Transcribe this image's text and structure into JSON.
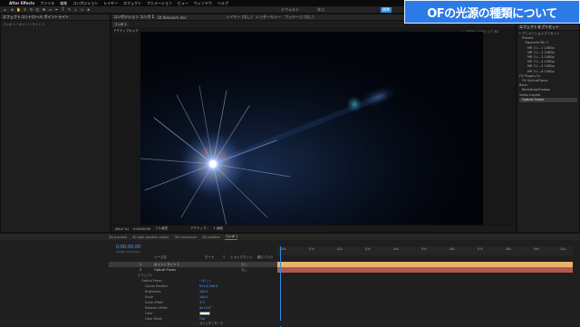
{
  "title_overlay": "OFの光源の種類について",
  "menubar": {
    "app": "After Effects",
    "items": [
      "ファイル",
      "編集",
      "コンポジション",
      "レイヤー",
      "エフェクト",
      "アニメーション",
      "ビュー",
      "ウィンドウ",
      "ヘルプ"
    ]
  },
  "toolbar": {
    "workspace_tabs": [
      "デフォルト",
      "学ぶ",
      "標準"
    ],
    "active_tab": "標準"
  },
  "effect_panel": {
    "tab": "エフェクトコントロール ポイントライト",
    "subline": "コンポ 1 • ポイントライト 1"
  },
  "comp_panel": {
    "tabs": [
      "コンポジション コンポ 1",
      "Bt.Newdom dec",
      "レイヤー (なし)",
      "レンダーキュー",
      "フッテージ (なし)"
    ],
    "inner_tab": "コンポ 1",
    "active_camera": "アクティブカメラ",
    "renderer": "レンダラー: クラシック 3D",
    "footer": [
      "(84.4 %)",
      "0:00:00:00",
      "フル画質",
      "アクティブ...",
      "1 画面"
    ]
  },
  "right_panel": {
    "header": "エフェクト＆プリセット",
    "tree": [
      "* アニメーションプリセット",
      "Presets",
      "Trapcode Mir 3",
      "MR 3 L...1 1080p",
      "MR 3 L...2 1080p",
      "MR 3 L...3 1080p",
      "MR 3 L...4 1080p",
      "MR 3 L...5 1080p",
      "MR 3 L...6 1080p",
      "FX Plugins Fx",
      "FX OpticalFlares",
      "Boris",
      "BorisDropShadow",
      "Video Copilot",
      "Optical Flares"
    ],
    "selected": "Optical Flares"
  },
  "timeline": {
    "tabs": [
      "3D preview",
      "3D light position colour",
      "3D luminance",
      "3D shelties",
      "コンポ 1"
    ],
    "active_tab": "コンポ 1",
    "timecode": "0:00:00:00",
    "frames": "00000 (30.00 fps)",
    "columns": [
      "ソース名",
      "モード",
      "T",
      "トラックマット",
      "親とリンク"
    ],
    "layers": [
      {
        "num": "1",
        "name": "ポイントライト 1",
        "mode": "なし",
        "color": "#e8b36a"
      },
      {
        "num": "2",
        "name": "Optical Flares",
        "mode": "なし",
        "color": "#d4796a"
      }
    ],
    "props": [
      {
        "name": "エフェクト",
        "value": ""
      },
      {
        "name": "Optical Flares",
        "value": "リセット"
      },
      {
        "name": "Center Position",
        "value": "814.8,506.0"
      },
      {
        "name": "Brightness",
        "value": "100.0"
      },
      {
        "name": "Scale",
        "value": "100.0"
      },
      {
        "name": "Scale Offset",
        "value": "オフ"
      },
      {
        "name": "Rotation Offset",
        "value": "0x+0.0°"
      },
      {
        "name": "Color",
        "value": ""
      },
      {
        "name": "Color Mode",
        "value": "Tint"
      }
    ],
    "ruler_ticks": [
      "00s",
      "01s",
      "02s",
      "03s",
      "04s",
      "05s",
      "06s",
      "07s",
      "08s",
      "09s",
      "10s"
    ],
    "footer": "スイッチ / モード"
  },
  "colors": {
    "accent": "#2d8ceb",
    "overlay": "#2b7ae6",
    "layer1": "#e8b36a",
    "layer2": "#d4796a"
  }
}
